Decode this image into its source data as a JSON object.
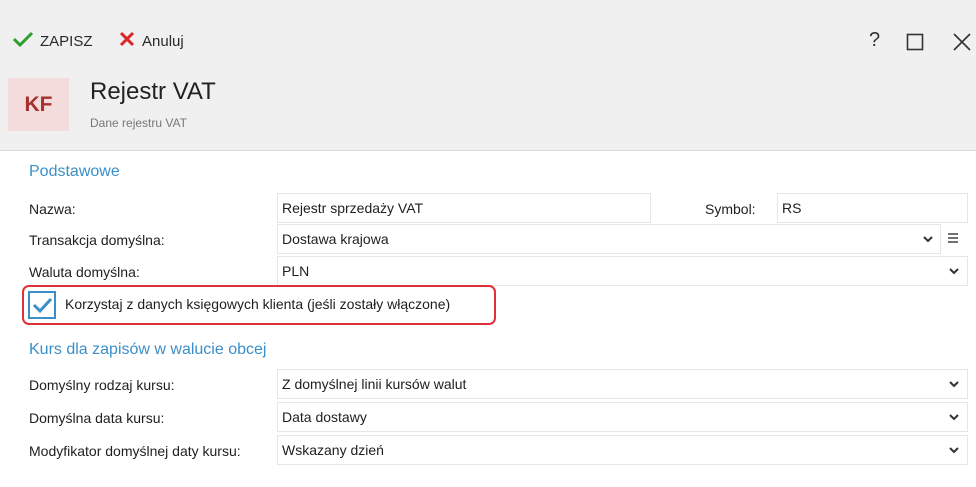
{
  "toolbar": {
    "save_label": "ZAPISZ",
    "cancel_label": "Anuluj",
    "help_label": "?"
  },
  "header": {
    "badge": "KF",
    "title": "Rejestr VAT",
    "subtitle": "Dane rejestru VAT"
  },
  "basic": {
    "section_title": "Podstawowe",
    "name_label": "Nazwa:",
    "name_value": "Rejestr sprzedaży VAT",
    "symbol_label": "Symbol:",
    "symbol_value": "RS",
    "transaction_label": "Transakcja domyślna:",
    "transaction_value": "Dostawa krajowa",
    "currency_label": "Waluta domyślna:",
    "currency_value": "PLN",
    "checkbox_label": "Korzystaj z danych księgowych klienta (jeśli zostały włączone)",
    "checkbox_checked": true
  },
  "rates": {
    "section_title": "Kurs dla zapisów w walucie obcej",
    "rate_type_label": "Domyślny rodzaj kursu:",
    "rate_type_value": "Z domyślnej linii kursów walut",
    "rate_date_label": "Domyślna data kursu:",
    "rate_date_value": "Data dostawy",
    "rate_modifier_label": "Modyfikator domyślnej daty kursu:",
    "rate_modifier_value": "Wskazany dzień"
  },
  "colors": {
    "accent": "#3a8fc8",
    "save_green": "#2e9e2e",
    "cancel_red": "#d9262c",
    "highlight": "#e0303a",
    "badge_bg": "#f4dcdc",
    "badge_text": "#a6322e"
  }
}
